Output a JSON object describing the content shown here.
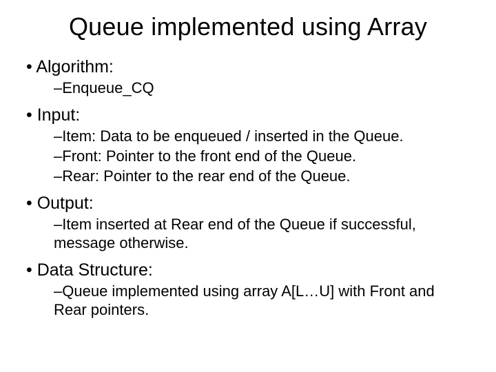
{
  "title": "Queue implemented using Array",
  "sections": {
    "algorithm": {
      "heading": "Algorithm:",
      "items": [
        "Enqueue_CQ"
      ]
    },
    "input": {
      "heading": "Input:",
      "items": [
        "Item: Data to be enqueued / inserted in the Queue.",
        "Front: Pointer to the front end of the Queue.",
        "Rear: Pointer to the rear end of the Queue."
      ]
    },
    "output": {
      "heading": "Output:",
      "items": [
        "Item inserted at Rear end of the Queue if successful, message otherwise."
      ]
    },
    "dataStructure": {
      "heading": "Data Structure:",
      "items": [
        "Queue implemented using array A[L…U] with Front and Rear pointers."
      ]
    }
  }
}
